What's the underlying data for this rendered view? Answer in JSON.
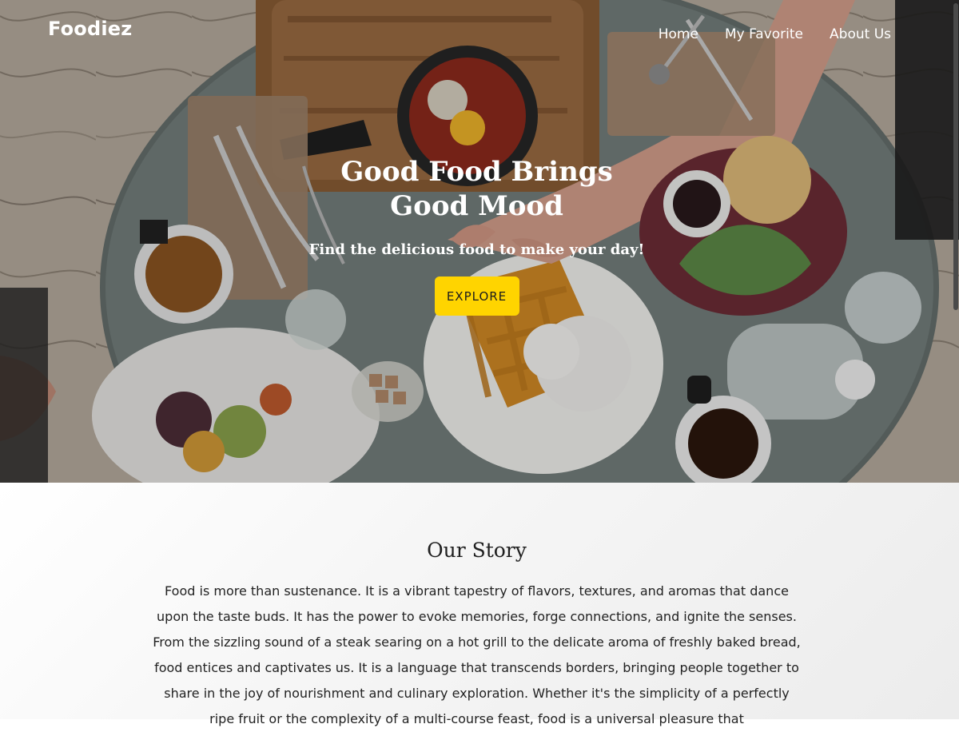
{
  "brand": {
    "name": "Foodiez"
  },
  "nav": {
    "items": [
      {
        "label": "Home"
      },
      {
        "label": "My Favorite"
      },
      {
        "label": "About Us"
      }
    ]
  },
  "hero": {
    "title_line1": "Good Food Brings",
    "title_line2": "Good Mood",
    "subtitle": "Find the delicious food to make your day!",
    "button_label": "EXPLORE",
    "button_color": "#ffd400"
  },
  "story": {
    "title": "Our Story",
    "text": "Food is more than sustenance. It is a vibrant tapestry of flavors, textures, and aromas that dance upon the taste buds. It has the power to evoke memories, forge connections, and ignite the senses. From the sizzling sound of a steak searing on a hot grill to the delicate aroma of freshly baked bread, food entices and captivates us. It is a language that transcends borders, bringing people together to share in the joy of nourishment and culinary exploration. Whether it's the simplicity of a perfectly ripe fruit or the complexity of a multi-course feast, food is a universal pleasure that"
  }
}
